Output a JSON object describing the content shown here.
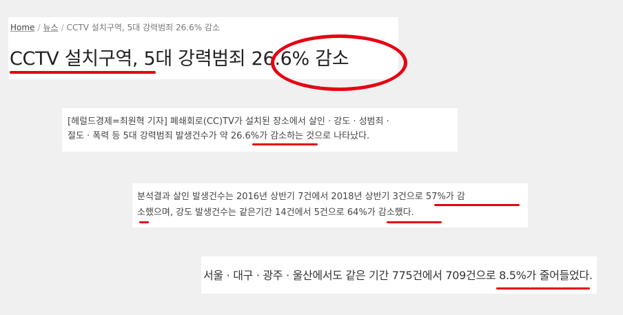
{
  "breadcrumb": {
    "home": "Home",
    "section": "뉴스",
    "current": "CCTV 설치구역, 5대 강력범죄 26.6% 감소"
  },
  "article": {
    "title": "CCTV 설치구역, 5대 강력범죄 26.6% 감소",
    "para1_line1": "[헤럴드경제=최원혁 기자] 폐쇄회로(CC)TV가 설치된 장소에서 살인 · 강도 · 성범죄 ·",
    "para1_line2": "절도 · 폭력 등 5대 강력범죄 발생건수가 약 26.6%가 감소하는 것으로 나타났다.",
    "para2_line1": "분석결과 살인 발생건수는 2016년 상반기 7건에서 2018년 상반기 3건으로 57%가 감",
    "para2_line2": "소했으며, 강도 발생건수는 같은기간 14건에서 5건으로 64%가 감소했다.",
    "para3": "서울 · 대구 · 광주 · 울산에서도 같은 기간 775건에서 709건으로 8.5%가 줄어들었다."
  },
  "colors": {
    "highlight": "#e60012",
    "background": "#f0f0f0",
    "panel": "#ffffff"
  }
}
